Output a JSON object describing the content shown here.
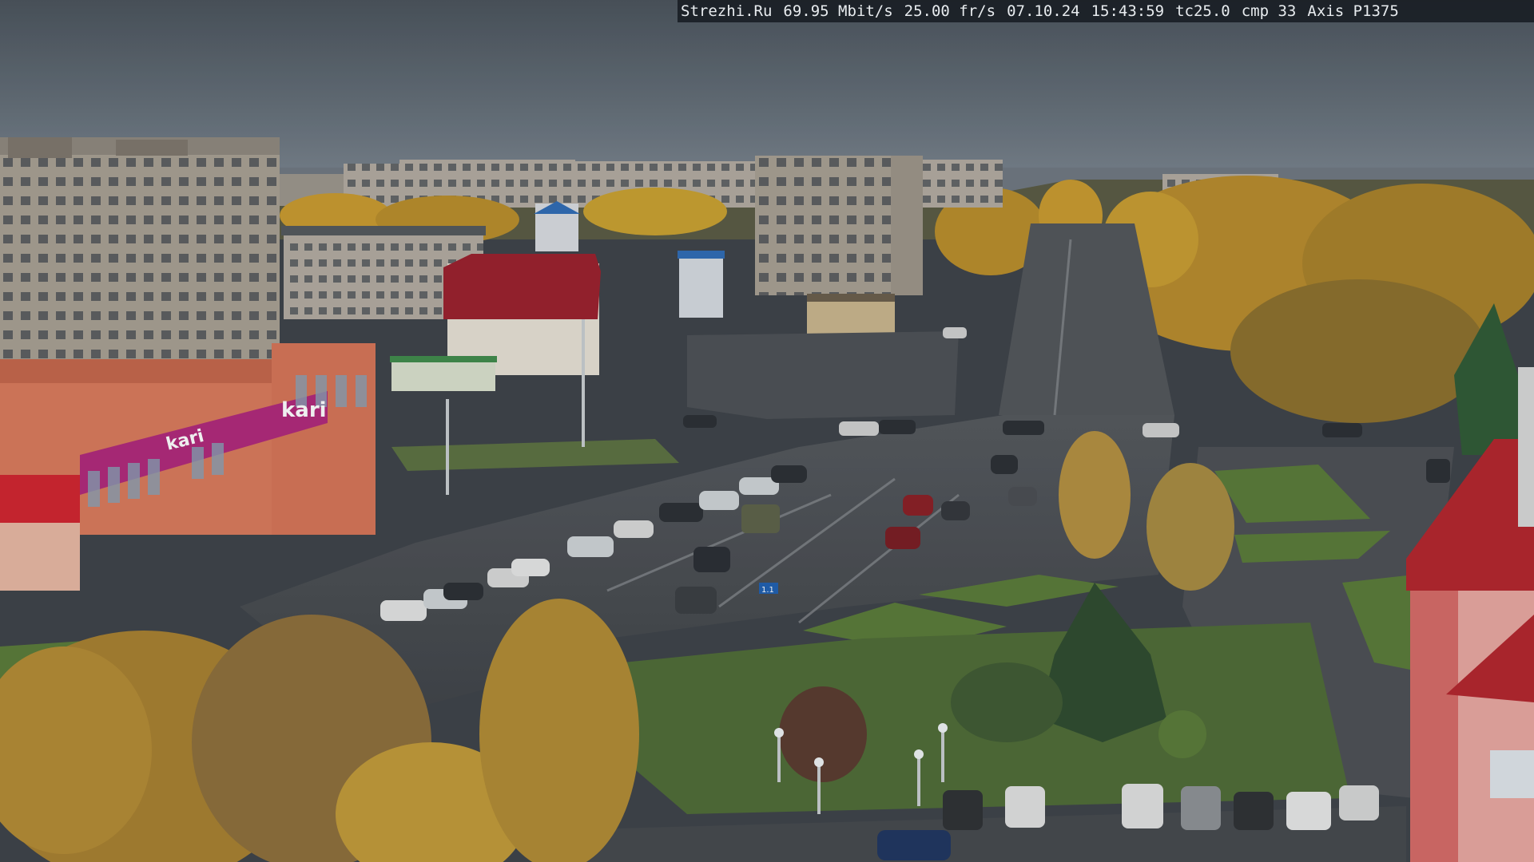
{
  "osd": {
    "site": "Strezhi.Ru",
    "bitrate": "69.95 Mbit/s",
    "framerate": "25.00 fr/s",
    "date": "07.10.24",
    "time": "15:43:59",
    "tc": "tc25.0",
    "cmp": "cmp 33",
    "camera": "Axis P1375"
  },
  "signs": {
    "kari_store": "kari",
    "banner_text": "kari",
    "road_sign": "1.1"
  },
  "colors": {
    "sky": "#5b646d",
    "asphalt": "#4a4d52",
    "grass": "#4f6b36",
    "autumn": "#c99a2e",
    "kari_magenta": "#b0287a",
    "roof_red": "#b3242c"
  }
}
